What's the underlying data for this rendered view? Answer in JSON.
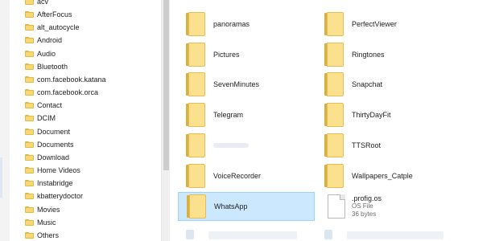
{
  "tree": {
    "items": [
      {
        "label": "acv"
      },
      {
        "label": "AfterFocus"
      },
      {
        "label": "alt_autocycle"
      },
      {
        "label": "Android"
      },
      {
        "label": "Audio"
      },
      {
        "label": "Bluetooth"
      },
      {
        "label": "com.facebook.katana"
      },
      {
        "label": "com.facebook.orca"
      },
      {
        "label": "Contact"
      },
      {
        "label": "DCIM"
      },
      {
        "label": "Document"
      },
      {
        "label": "Documents"
      },
      {
        "label": "Download"
      },
      {
        "label": "Home Videos"
      },
      {
        "label": "Instabridge"
      },
      {
        "label": "kbatterydoctor"
      },
      {
        "label": "Movies"
      },
      {
        "label": "Music"
      },
      {
        "label": "Others"
      }
    ]
  },
  "content": {
    "left_column": [
      {
        "name": "panoramas"
      },
      {
        "name": "Pictures"
      },
      {
        "name": "SevenMinutes"
      },
      {
        "name": "Telegram"
      },
      {
        "name": ""
      },
      {
        "name": "VoiceRecorder"
      },
      {
        "name": "WhatsApp",
        "selected": true
      }
    ],
    "right_column": [
      {
        "name": "PerfectViewer"
      },
      {
        "name": "Ringtones"
      },
      {
        "name": "Snapchat"
      },
      {
        "name": "ThirtyDayFit"
      },
      {
        "name": "TTSRoot"
      },
      {
        "name": "Wallpapers_Catple"
      }
    ],
    "file": {
      "name": ".profig.os",
      "type": "OS File",
      "size": "36 bytes"
    }
  },
  "colors": {
    "folder": "#f8d775",
    "selection": "#cce8ff",
    "selection_border": "#99d1ff"
  }
}
